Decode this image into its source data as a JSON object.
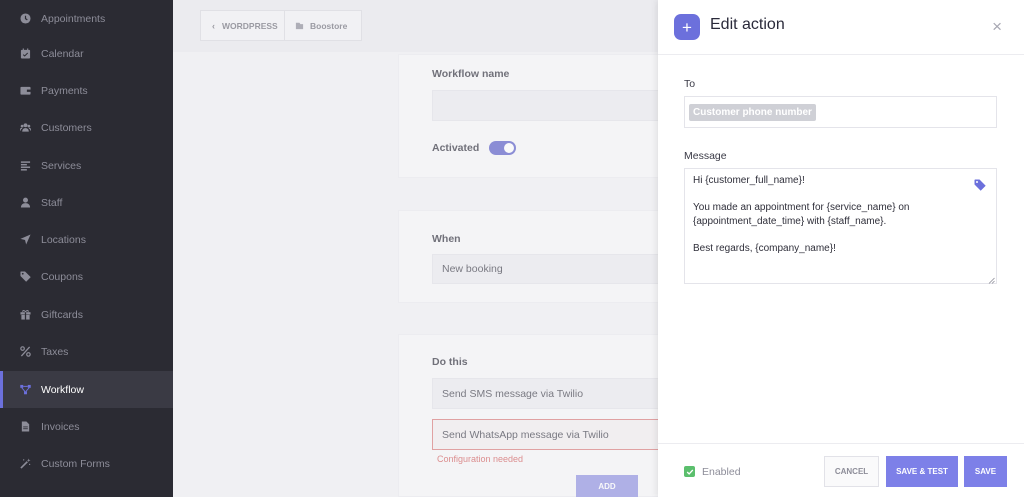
{
  "sidebar": {
    "items": [
      {
        "label": "Appointments",
        "icon": "clock-icon"
      },
      {
        "label": "Calendar",
        "icon": "calendar-icon"
      },
      {
        "label": "Payments",
        "icon": "wallet-icon"
      },
      {
        "label": "Customers",
        "icon": "users-icon"
      },
      {
        "label": "Services",
        "icon": "list-icon"
      },
      {
        "label": "Staff",
        "icon": "user-icon"
      },
      {
        "label": "Locations",
        "icon": "location-arrow-icon"
      },
      {
        "label": "Coupons",
        "icon": "tag-icon"
      },
      {
        "label": "Giftcards",
        "icon": "gift-icon"
      },
      {
        "label": "Taxes",
        "icon": "percent-icon"
      },
      {
        "label": "Workflow",
        "icon": "workflow-icon",
        "active": true
      },
      {
        "label": "Invoices",
        "icon": "file-icon"
      },
      {
        "label": "Custom Forms",
        "icon": "magic-wand-icon"
      }
    ]
  },
  "breadcrumb": {
    "back_label": "WORDPRESS",
    "brand_label": "Boostore"
  },
  "workflow_form": {
    "name_label": "Workflow name",
    "name_value": "",
    "activated_label": "Activated",
    "when_label": "When",
    "when_value": "New booking",
    "do_this_label": "Do this",
    "actions": [
      {
        "label": "Send SMS message via Twilio",
        "error": false
      },
      {
        "label": "Send WhatsApp message via Twilio",
        "error": true
      }
    ],
    "config_needed": "Configuration needed",
    "add_button": "ADD"
  },
  "edit_panel": {
    "title": "Edit action",
    "close": "×",
    "to_label": "To",
    "to_tag": "Customer phone number",
    "message_label": "Message",
    "message_lines": [
      "Hi {customer_full_name}!",
      "",
      "You made an appointment for {service_name} on",
      "{appointment_date_time} with {staff_name}.",
      "",
      "Best regards, {company_name}!"
    ],
    "enabled_label": "Enabled",
    "cancel_button": "CANCEL",
    "save_test_button": "SAVE & TEST",
    "save_button": "SAVE"
  },
  "colors": {
    "accent": "#6c70dc",
    "sidebar_bg": "#2b2b33",
    "enabled_green": "#5bbf6d",
    "error_red": "#d25a5a"
  }
}
